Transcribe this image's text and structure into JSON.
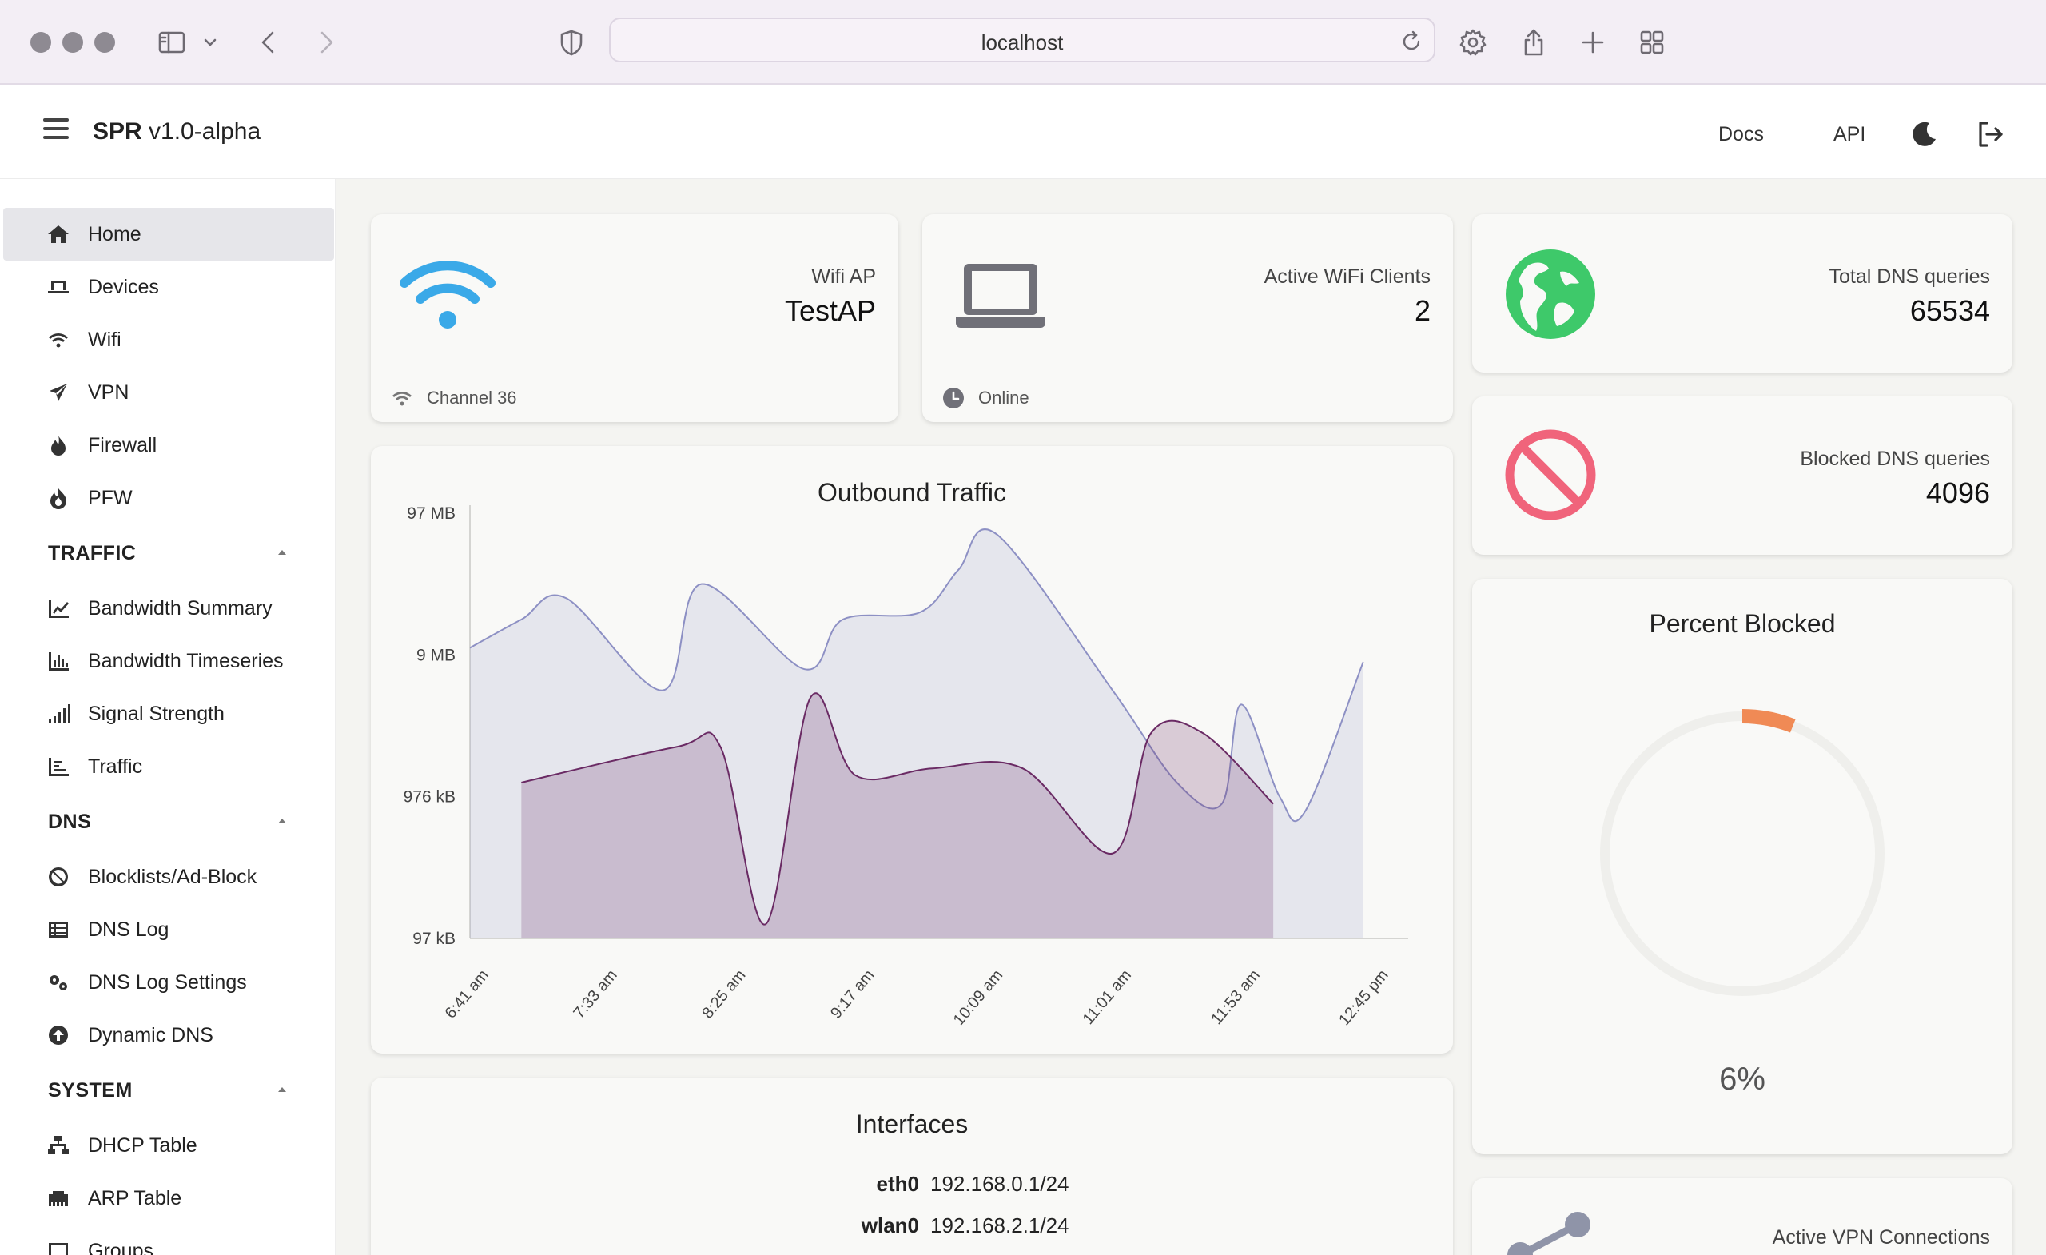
{
  "browser": {
    "url": "localhost"
  },
  "header": {
    "brand_bold": "SPR",
    "brand_version": "v1.0-alpha",
    "links": [
      "Docs",
      "API"
    ]
  },
  "sidebar": {
    "items": [
      {
        "label": "Home",
        "icon": "home-icon",
        "active": true
      },
      {
        "label": "Devices",
        "icon": "laptop-icon"
      },
      {
        "label": "Wifi",
        "icon": "wifi-icon"
      },
      {
        "label": "VPN",
        "icon": "send-icon"
      },
      {
        "label": "Firewall",
        "icon": "flame-icon"
      },
      {
        "label": "PFW",
        "icon": "fire-icon"
      }
    ],
    "traffic_section": "TRAFFIC",
    "traffic_items": [
      {
        "label": "Bandwidth Summary",
        "icon": "line-chart-icon"
      },
      {
        "label": "Bandwidth Timeseries",
        "icon": "bar-chart-icon"
      },
      {
        "label": "Signal Strength",
        "icon": "signal-icon"
      },
      {
        "label": "Traffic",
        "icon": "list-chart-icon"
      }
    ],
    "dns_section": "DNS",
    "dns_items": [
      {
        "label": "Blocklists/Ad-Block",
        "icon": "ban-icon"
      },
      {
        "label": "DNS Log",
        "icon": "table-icon"
      },
      {
        "label": "DNS Log Settings",
        "icon": "cogs-icon"
      },
      {
        "label": "Dynamic DNS",
        "icon": "circle-arrow-up-icon"
      }
    ],
    "system_section": "SYSTEM",
    "system_items": [
      {
        "label": "DHCP Table",
        "icon": "network-icon"
      },
      {
        "label": "ARP Table",
        "icon": "ethernet-icon"
      },
      {
        "label": "Groups",
        "icon": "groups-icon"
      }
    ]
  },
  "cards": {
    "wifi_ap": {
      "label": "Wifi AP",
      "value": "TestAP",
      "footer": "Channel 36"
    },
    "active_clients": {
      "label": "Active WiFi Clients",
      "value": "2",
      "footer": "Online"
    },
    "total_dns": {
      "label": "Total DNS queries",
      "value": "65534"
    },
    "blocked_dns": {
      "label": "Blocked DNS queries",
      "value": "4096"
    },
    "percent_blocked": {
      "title": "Percent Blocked",
      "value": "6%",
      "fraction": 0.06
    },
    "vpn": {
      "label": "Active VPN Connections"
    },
    "interfaces": {
      "title": "Interfaces",
      "rows": [
        {
          "name": "eth0",
          "addr": "192.168.0.1/24"
        },
        {
          "name": "wlan0",
          "addr": "192.168.2.1/24"
        }
      ]
    }
  },
  "colors": {
    "wifi_blue": "#3aa9e8",
    "globe_green": "#3ec96a",
    "ban_red": "#f0647b",
    "donut_orange": "#f08a55",
    "series1": "#8d90c4",
    "series2": "#6a2a64"
  },
  "chart_data": {
    "type": "area",
    "title": "Outbound Traffic",
    "y_axis_scale": "log",
    "y_ticks": [
      "97 kB",
      "976 kB",
      "9 MB",
      "97 MB"
    ],
    "categories": [
      "6:41 am",
      "7:33 am",
      "8:25 am",
      "9:17 am",
      "10:09 am",
      "11:01 am",
      "11:53 am",
      "12:45 pm"
    ],
    "series": [
      {
        "x": [
          0.0,
          0.4,
          0.75,
          1.5,
          1.8,
          2.6,
          2.9,
          3.5,
          3.8,
          4.1,
          5.0,
          5.5,
          5.85,
          6.0,
          6.3,
          6.5,
          6.95
        ],
        "values_log10_kB": [
          4.05,
          4.25,
          4.4,
          3.75,
          4.5,
          3.9,
          4.25,
          4.3,
          4.6,
          4.85,
          3.75,
          3.1,
          2.95,
          3.65,
          3.0,
          2.9,
          3.95
        ]
      },
      {
        "x": [
          0.0,
          1.2,
          1.55,
          1.9,
          2.25,
          2.6,
          3.2,
          3.9,
          4.6,
          4.9,
          5.3,
          5.85
        ],
        "values_log10_kB": [
          3.1,
          3.35,
          3.35,
          2.1,
          3.7,
          3.15,
          3.2,
          3.2,
          2.6,
          3.45,
          3.45,
          2.95
        ]
      }
    ]
  }
}
